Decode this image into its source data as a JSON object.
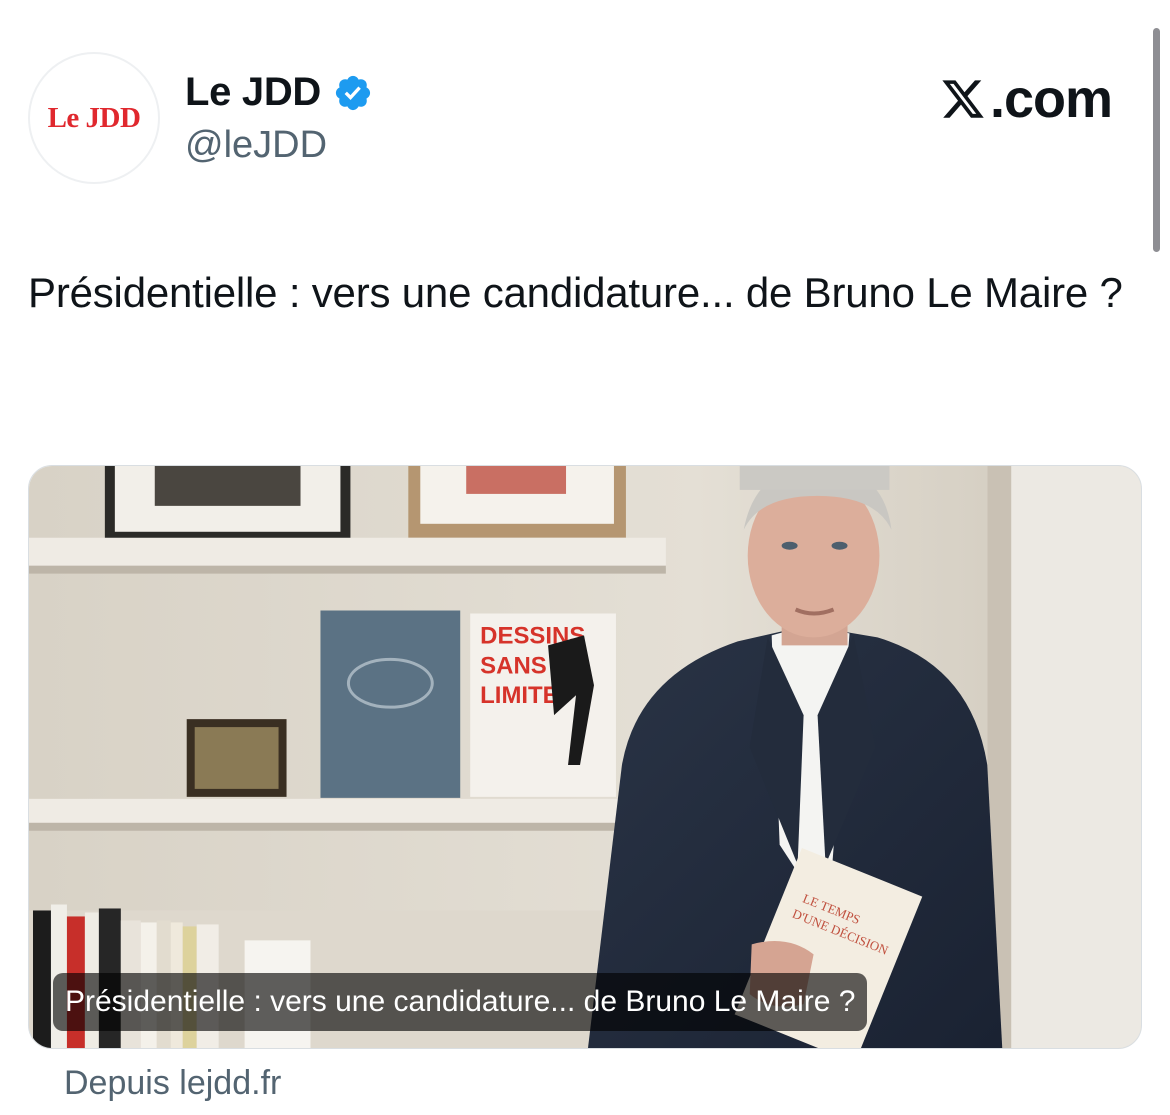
{
  "author": {
    "avatar_text": "Le JDD",
    "name": "Le JDD",
    "handle": "@leJDD",
    "verified_icon": "verified-badge-icon",
    "verified_color": "#1d9bf0"
  },
  "brand": {
    "label": ".com",
    "icon": "x-logo-icon"
  },
  "tweet": {
    "text": "Présidentielle : vers une candidature... de Bruno Le Maire ?"
  },
  "card": {
    "image_icon": "article-photo",
    "caption": "Présidentielle : vers une candidature... de Bruno Le Maire ?",
    "source": "Depuis lejdd.fr",
    "book_title_red": "DESSINS SANS LIMITE",
    "book_in_hand": "LE TEMPS D'UNE DÉCISION"
  },
  "colors": {
    "text_primary": "#0f1419",
    "text_secondary": "#536471",
    "logo_red": "#e0282e"
  }
}
